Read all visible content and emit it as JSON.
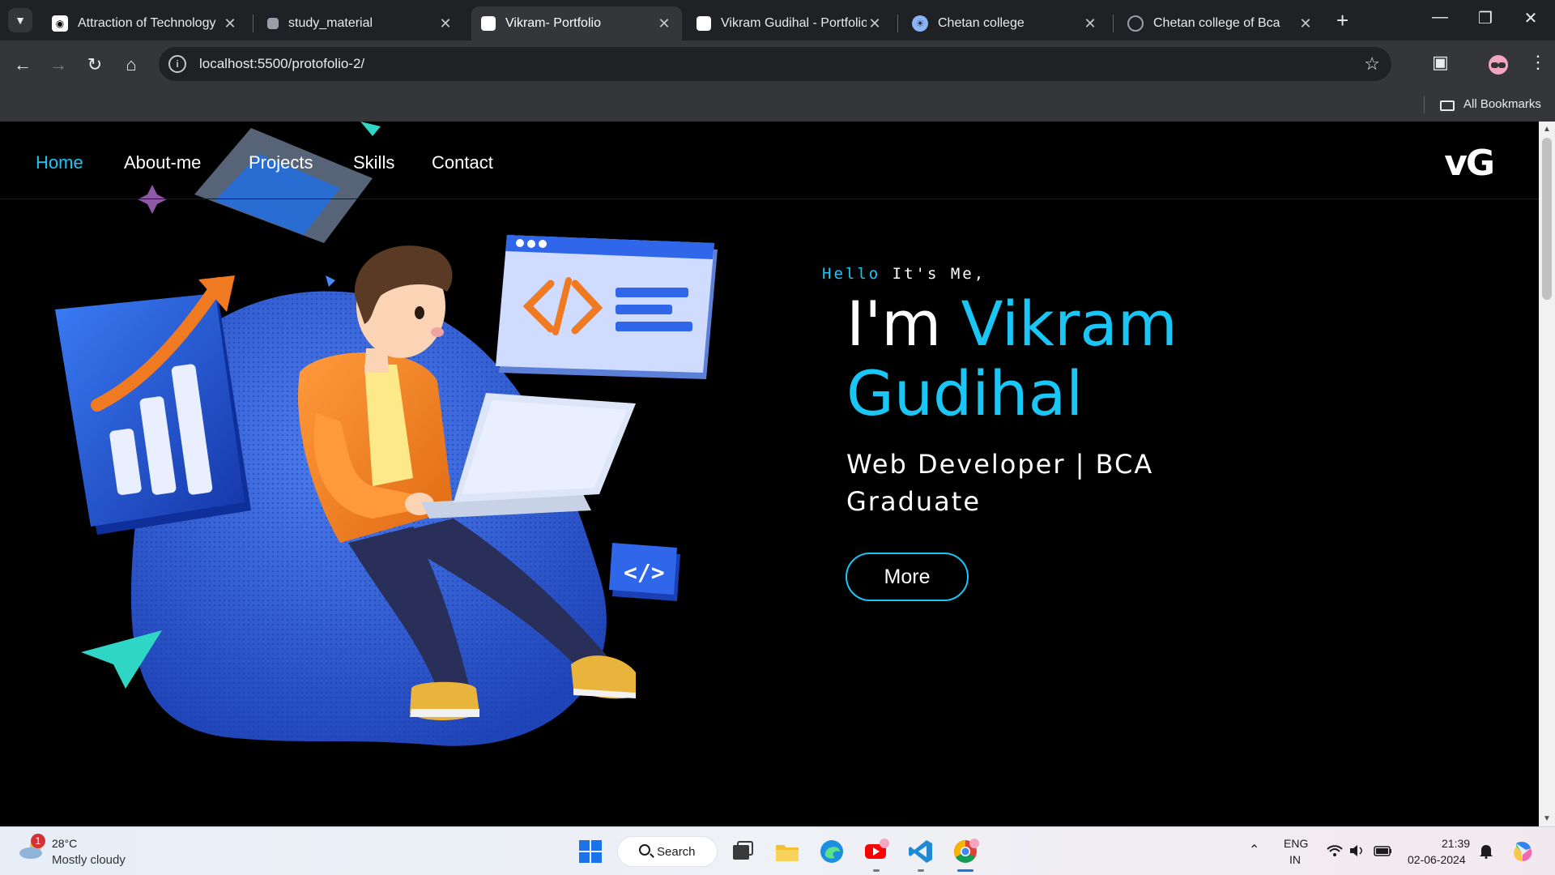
{
  "browser": {
    "tabs": [
      {
        "title": "Attraction of Technology",
        "active": false
      },
      {
        "title": "study_material",
        "active": false
      },
      {
        "title": "Vikram- Portfolio",
        "active": true
      },
      {
        "title": "Vikram Gudihal - Portfolio",
        "active": false
      },
      {
        "title": "Chetan college",
        "active": false
      },
      {
        "title": "Chetan college of Bca",
        "active": false
      }
    ],
    "url": "localhost:5500/protofolio-2/",
    "bookmarks_label": "All Bookmarks"
  },
  "site": {
    "nav": [
      "Home",
      "About-me",
      "Projects",
      "Skills",
      "Contact"
    ],
    "logo": "vG",
    "hello_1": "Hello",
    "hello_2": " It's Me,",
    "headline_1": "I'm ",
    "headline_2": "Vikram Gudihal",
    "subtitle": "Web Developer | BCA Graduate",
    "more_label": "More",
    "accent_color": "#19c6f5"
  },
  "taskbar": {
    "weather_badge": "1",
    "temperature": "28°C",
    "weather_desc": "Mostly cloudy",
    "search_label": "Search",
    "lang_1": "ENG",
    "lang_2": "IN",
    "time": "21:39",
    "date": "02-06-2024"
  }
}
